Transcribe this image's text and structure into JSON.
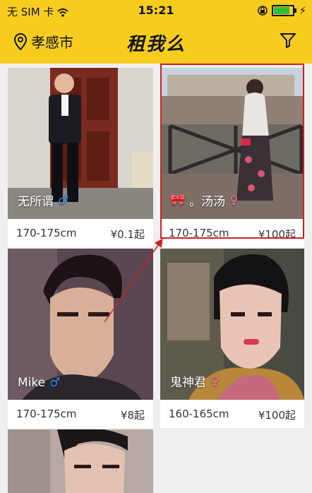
{
  "status_bar": {
    "carrier": "无 SIM 卡",
    "time": "15:21",
    "battery_percent": 85
  },
  "nav": {
    "location": "孝感市",
    "title": "租我么"
  },
  "cards": [
    {
      "name": "无所谓",
      "gender": "♂",
      "height": "170-175cm",
      "price": "¥0.1起"
    },
    {
      "name": "。汤汤",
      "gender": "♀",
      "height": "170-175cm",
      "price": "¥100起"
    },
    {
      "name": "Mike",
      "gender": "♂",
      "height": "170-175cm",
      "price": "¥8起"
    },
    {
      "name": "鬼神君",
      "gender": "♀",
      "height": "160-165cm",
      "price": "¥100起"
    }
  ]
}
